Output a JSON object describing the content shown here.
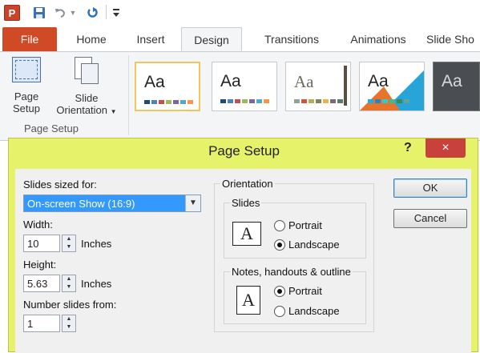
{
  "qat": {
    "app_icon_letter": "P",
    "icons": [
      "powerpoint-app-icon",
      "save-icon",
      "undo-icon",
      "redo-icon",
      "customize-qat-icon"
    ]
  },
  "tabs": [
    "File",
    "Home",
    "Insert",
    "Design",
    "Transitions",
    "Animations",
    "Slide Sho"
  ],
  "active_tab": "Design",
  "ribbon": {
    "page_setup_label_1": "Page",
    "page_setup_label_2": "Setup",
    "slide_orientation_label_1": "Slide",
    "slide_orientation_label_2": "Orientation",
    "group_label": "Page Setup",
    "theme_sample_text": "Aa"
  },
  "dialog": {
    "title": "Page Setup",
    "help": "?",
    "close": "×",
    "slides_sized_for_label": "Slides sized for:",
    "slides_sized_for_value": "On-screen Show (16:9)",
    "width_label": "Width:",
    "width_value": "10",
    "width_unit": "Inches",
    "height_label": "Height:",
    "height_value": "5.63",
    "height_unit": "Inches",
    "number_from_label": "Number slides from:",
    "number_from_value": "1",
    "orientation_label": "Orientation",
    "slides_group_label": "Slides",
    "notes_group_label": "Notes, handouts & outline",
    "portrait_label": "Portrait",
    "landscape_label": "Landscape",
    "slides_orientation_selected": "Landscape",
    "notes_orientation_selected": "Portrait",
    "ok_label": "OK",
    "cancel_label": "Cancel"
  },
  "colors": {
    "file_tab": "#d04a26",
    "dialog_frame": "#e6f26a",
    "close_button": "#c9413b",
    "selection": "#3399ff"
  }
}
